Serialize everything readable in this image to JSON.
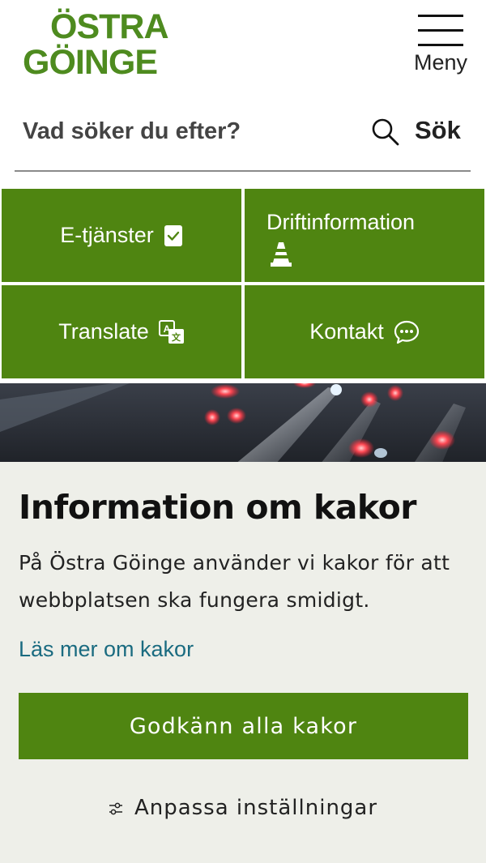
{
  "header": {
    "logo_line1": "ÖSTRA",
    "logo_line2": "GÖINGE",
    "menu_label": "Meny"
  },
  "search": {
    "placeholder": "Vad söker du efter?",
    "button_label": "Sök"
  },
  "tiles": [
    {
      "label": "E-tjänster",
      "icon": "checkbox-icon"
    },
    {
      "label": "Driftinformation",
      "icon": "traffic-cone-icon"
    },
    {
      "label": "Translate",
      "icon": "translate-icon"
    },
    {
      "label": "Kontakt",
      "icon": "chat-bubble-icon"
    }
  ],
  "cookie": {
    "title": "Information om kakor",
    "body": "På Östra Göinge använder vi kakor för att webbplatsen ska fungera smidigt.",
    "read_more": "Läs mer om kakor",
    "accept_label": "Godkänn alla kakor",
    "settings_label": "Anpassa inställningar"
  },
  "colors": {
    "brand_green": "#4f8511",
    "logo_green": "#4e8b1f",
    "link_teal": "#1a6b80",
    "cookie_bg": "#eeefe9"
  }
}
